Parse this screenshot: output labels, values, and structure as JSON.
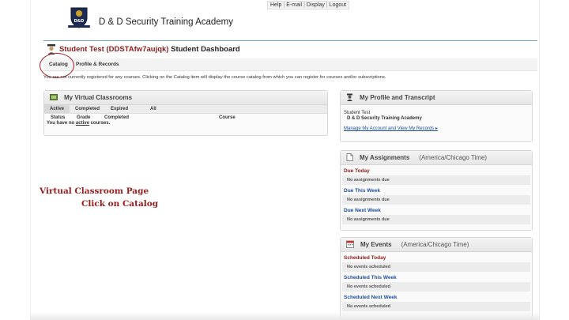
{
  "toplinks": [
    "Help",
    "E-mail",
    "Display",
    "Logout"
  ],
  "header": {
    "academy_name": "D & D Security Training Academy",
    "logo_text": "D&D"
  },
  "dashboard": {
    "user_name": "Student Test (DDSTAfw7aujqk)",
    "title_suffix": " Student Dashboard"
  },
  "nav": {
    "catalog": "Catalog",
    "profile": "Profile & Records"
  },
  "notice": "You are not currently registered for any courses. Clicking on the Catalog item will display the course catalog from which you can register for courses and/or subscriptions.",
  "virtual_classrooms": {
    "title": "My Virtual Classrooms",
    "tabs": [
      "Active",
      "Completed",
      "Expired",
      "All"
    ],
    "columns": [
      "Status",
      "Grade",
      "Completed",
      "Course"
    ],
    "message_pre": "You have no ",
    "message_link": "active",
    "message_post": " courses."
  },
  "profile": {
    "title": "My Profile and Transcript",
    "name": "Student Test",
    "org": "D & D Security Training Academy",
    "link": "Manage My Account and View My Records ▸"
  },
  "assignments": {
    "title": "My Assignments",
    "timezone": "(America/Chicago Time)",
    "sections": [
      {
        "label": "Due Today",
        "empty": "No assignments due"
      },
      {
        "label": "Due This Week",
        "empty": "No assignments due"
      },
      {
        "label": "Due Next Week",
        "empty": "No assignments due"
      }
    ]
  },
  "events": {
    "title": "My Events",
    "timezone": "(America/Chicago Time)",
    "sections": [
      {
        "label": "Scheduled Today",
        "empty": "No events scheduled"
      },
      {
        "label": "Scheduled This Week",
        "empty": "No events scheduled"
      },
      {
        "label": "Scheduled Next Week",
        "empty": "No events scheduled"
      }
    ]
  },
  "annotation": {
    "line1": "Virtual Classroom Page",
    "line2": "Click on Catalog"
  },
  "colors": {
    "accent_red": "#8a1c1c",
    "link_blue": "#1f4fa0",
    "rule_blue": "#6ea2c9",
    "annotation_red": "#9a1b1b"
  }
}
